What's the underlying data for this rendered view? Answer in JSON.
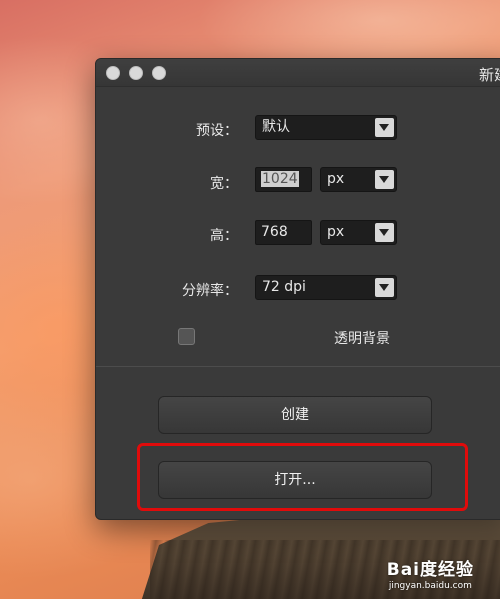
{
  "window": {
    "title": "新建"
  },
  "form": {
    "preset": {
      "label": "预设：",
      "value": "默认"
    },
    "width": {
      "label": "宽：",
      "value": "1024",
      "unit": "px"
    },
    "height": {
      "label": "高：",
      "value": "768",
      "unit": "px"
    },
    "resolution": {
      "label": "分辨率：",
      "value": "72 dpi"
    },
    "transparent": {
      "label": "透明背景",
      "checked": false
    }
  },
  "buttons": {
    "create": "创建",
    "open": "打开..."
  },
  "watermark": {
    "logo": "Bai度经验",
    "url": "jingyan.baidu.com"
  },
  "colors": {
    "window_bg": "#3a3a3a",
    "highlight": "#e00b0b"
  }
}
